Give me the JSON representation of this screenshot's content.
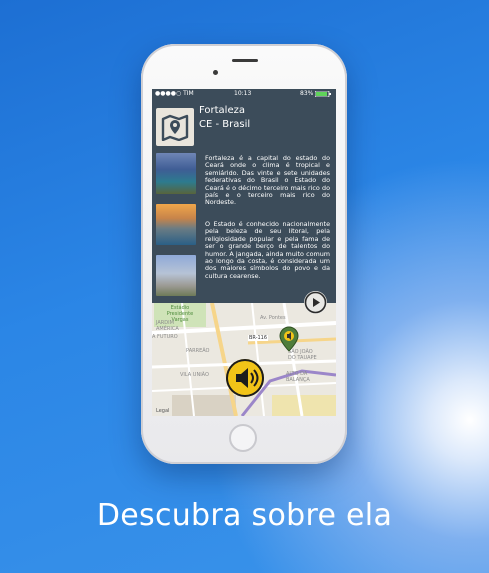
{
  "status_bar": {
    "carrier": "●●●●○ TIM",
    "time": "10:13",
    "battery": "83%"
  },
  "place": {
    "city": "Fortaleza",
    "state": "CE - Brasil"
  },
  "descriptions": [
    "Fortaleza é a capital do estado do Ceará onde o clima é tropical e semiárido. Das vinte e sete unidades federativas do Brasil o Estado do Ceará é o décimo terceiro mais rico do país e o terceiro mais rico do Nordeste.",
    "O Estado é conhecido nacionalmente pela beleza de seu litoral, pela religiosidade popular e pela fama de ser o grande berço de talentos do humor. A jangada, ainda muito comum ao longo da costa, é considerada um dos maiores símbolos do povo e da cultura cearense."
  ],
  "map_labels": {
    "park": "Estádio Presidente Vargas",
    "jardim": "JARDIM AMÉRICA",
    "futuro": "A FUTURO",
    "parreao": "PARREÃO",
    "vila": "VILA UNIÃO",
    "br": "BR-116",
    "sao_joao": "SÃO JOÃO DO TAUAPE",
    "alto": "ALTO DA BALANÇA",
    "legal": "Legal",
    "av": "Av. Pontes"
  },
  "caption": "Descubra sobre ela",
  "colors": {
    "panel": "#3c4c5a",
    "audio_button": "#f2c418",
    "pin": "#4f7d3a"
  },
  "icons": [
    "map-pin-icon",
    "play-icon",
    "speaker-icon",
    "location-pin-icon"
  ]
}
